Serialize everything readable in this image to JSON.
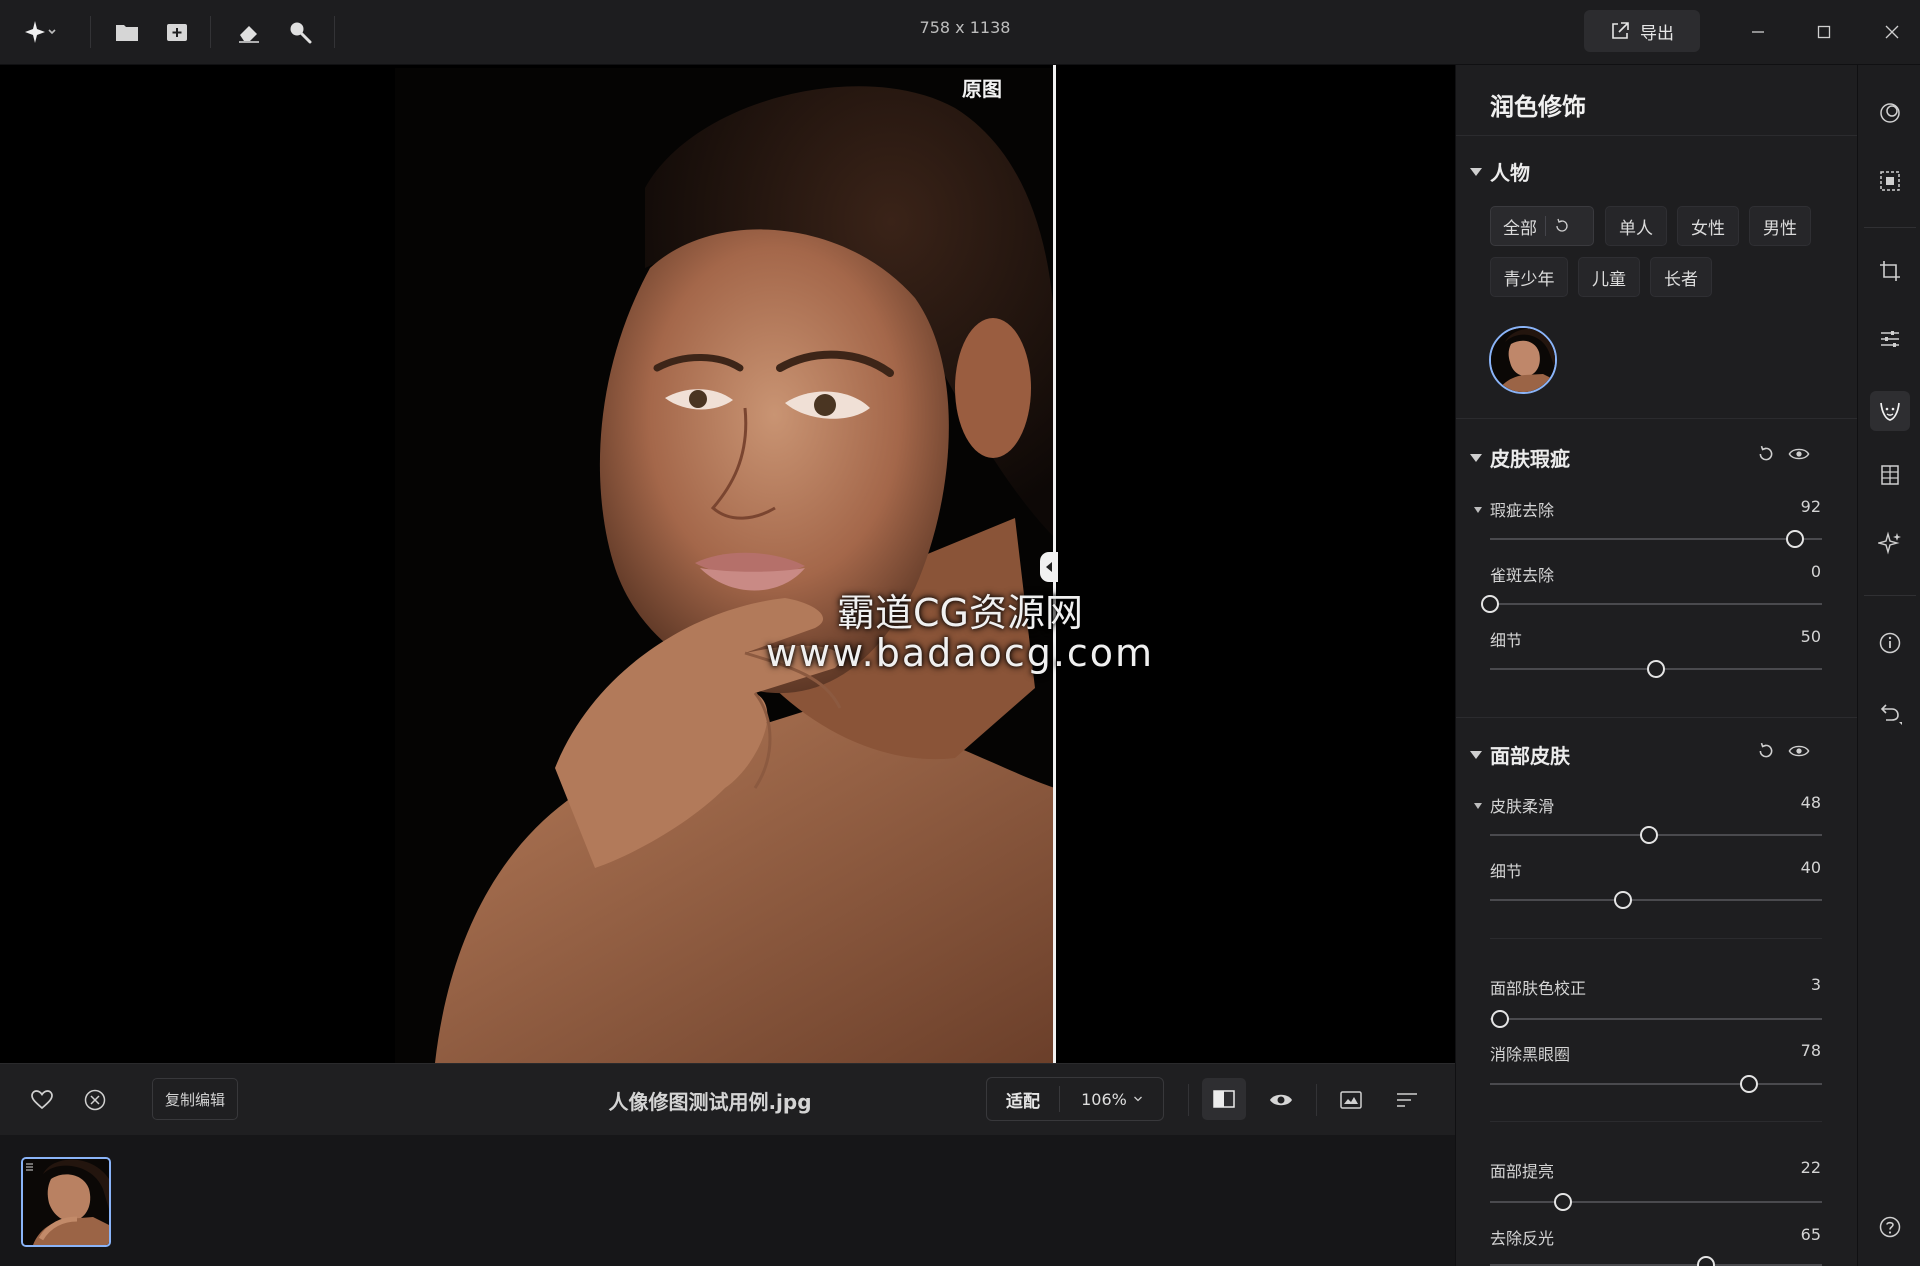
{
  "titlebar": {
    "dimensions": "758 x 1138",
    "export_label": "导出",
    "icons": [
      "sparkle-menu-icon",
      "folder-icon",
      "add-image-icon",
      "eraser-icon",
      "search-icon"
    ]
  },
  "canvas": {
    "original_label": "原图",
    "watermark_line1": "霸道CG资源网",
    "watermark_line2": "www.badaocg.com"
  },
  "bottombar": {
    "copy_edit_label": "复制编辑",
    "filename": "人像修图测试用例.jpg",
    "fit_label": "适配",
    "zoom_value": "106%"
  },
  "panel": {
    "title": "润色修饰",
    "person_section": {
      "title": "人物",
      "chips": [
        "全部",
        "单人",
        "女性",
        "男性",
        "青少年",
        "儿童",
        "长者"
      ]
    },
    "skin_blemish": {
      "title": "皮肤瑕疵",
      "sliders": [
        {
          "label": "瑕疵去除",
          "value": 92
        },
        {
          "label": "雀斑去除",
          "value": 0
        },
        {
          "label": "细节",
          "value": 50
        }
      ]
    },
    "face_skin": {
      "title": "面部皮肤",
      "sliders": [
        {
          "label": "皮肤柔滑",
          "value": 48
        },
        {
          "label": "细节",
          "value": 40
        },
        {
          "label": "面部肤色校正",
          "value": 3
        },
        {
          "label": "消除黑眼圈",
          "value": 78
        },
        {
          "label": "面部提亮",
          "value": 22
        },
        {
          "label": "去除反光",
          "value": 65
        }
      ]
    }
  },
  "colors": {
    "accent": "#8ab4f8",
    "panel_bg": "#1e1e20",
    "canvas_bg": "#000000"
  }
}
